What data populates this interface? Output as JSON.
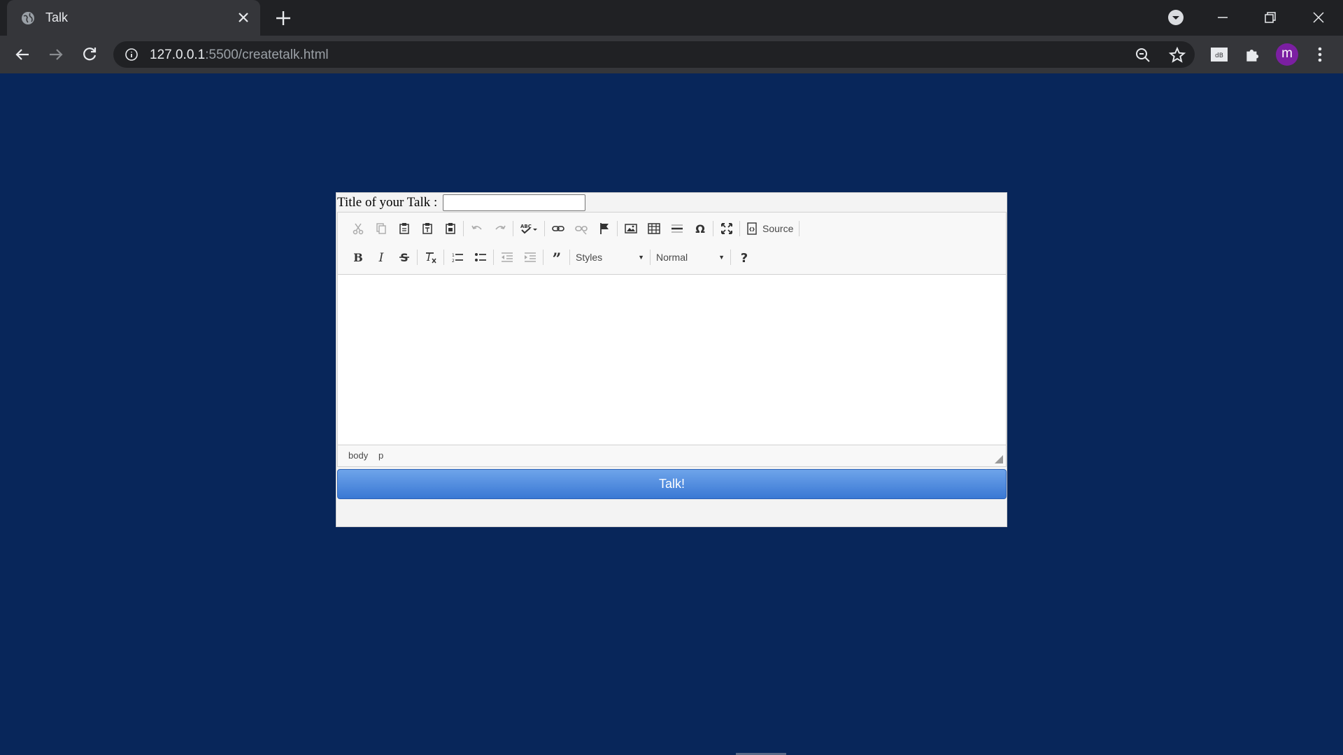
{
  "browser": {
    "tab_title": "Talk",
    "url_host": "127.0.0.1",
    "url_rest": ":5500/createtalk.html",
    "profile_initial": "m"
  },
  "form": {
    "title_label": "Title of your Talk :",
    "title_value": ""
  },
  "editor": {
    "toolbar_row1": [
      "cut-icon",
      "copy-icon",
      "paste-icon",
      "paste-text-icon",
      "paste-word-icon",
      "undo-icon",
      "redo-icon",
      "spellcheck-icon",
      "link-icon",
      "unlink-icon",
      "anchor-icon",
      "image-icon",
      "table-icon",
      "horizontal-rule-icon",
      "special-char-icon",
      "maximize-icon",
      "source-icon"
    ],
    "source_label": "Source",
    "toolbar_row2": [
      "bold-icon",
      "italic-icon",
      "strikethrough-icon",
      "remove-format-icon",
      "numbered-list-icon",
      "bulleted-list-icon",
      "outdent-icon",
      "indent-icon",
      "blockquote-icon",
      "help-icon"
    ],
    "styles_label": "Styles",
    "format_label": "Normal",
    "path": [
      "body",
      "p"
    ]
  },
  "submit_label": "Talk!",
  "colors": {
    "page_bg": "#08265a",
    "button": "#3a78d4"
  }
}
